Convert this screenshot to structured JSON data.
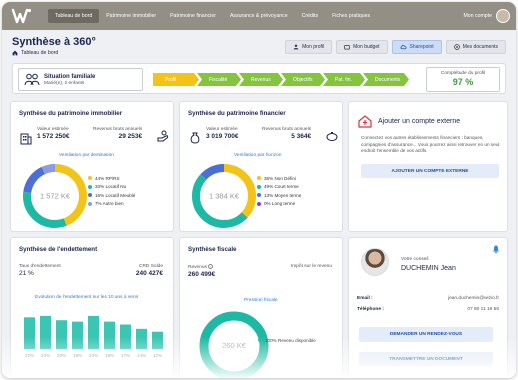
{
  "nav": {
    "items": [
      "Tableau de bord",
      "Patrimoine immobilier",
      "Patrimoine financier",
      "Assurance & prévoyance",
      "Crédits",
      "Fiches pratiques"
    ],
    "account_label": "Mon compte"
  },
  "header": {
    "title": "Synthèse à 360°",
    "breadcrumb": "Tableau de bord",
    "buttons": [
      "Mon profil",
      "Mon budget",
      "Sharepoint",
      "Mes documents"
    ]
  },
  "situation": {
    "title": "Situation familiale",
    "subtitle": "Marié(e), 2 enfants",
    "steps": [
      "Profil",
      "Fiscalité",
      "Revenus",
      "Objectifs",
      "Pat. fin.",
      "Documents"
    ],
    "completude_label": "Complétude du profil",
    "completude_value": "97 %"
  },
  "immobilier": {
    "title": "Synthèse du patrimoine immobilier",
    "value_label": "Valeur estimée",
    "value": "1 572 250€",
    "rent_label": "Revenus bruts annuels",
    "rent": "29 253€",
    "sub": "Ventilation par destination",
    "center": "1 572 K€",
    "legend": [
      {
        "label": "44% RP/RS",
        "color": "#f2c318"
      },
      {
        "label": "33% Locatif Nu",
        "color": "#1db9a5"
      },
      {
        "label": "16% Locatif Meublé",
        "color": "#4c6fd6"
      },
      {
        "label": "7% Autre bien",
        "color": "#8a9de0"
      }
    ]
  },
  "financier": {
    "title": "Synthèse du patrimoine financier",
    "value_label": "Valeur estimée",
    "value": "3 019 700€",
    "rent_label": "Revenus bruts annuels",
    "rent": "5 364€",
    "sub": "Ventilation par horizon",
    "center": "1 384 K€",
    "legend": [
      {
        "label": "36% Non Défini",
        "color": "#f2c318"
      },
      {
        "label": "49% Court terme",
        "color": "#1db9a5"
      },
      {
        "label": "13% Moyen terme",
        "color": "#4c6fd6"
      },
      {
        "label": "0% Long terme",
        "color": "#8a3fd0"
      }
    ]
  },
  "externe": {
    "title": "Ajouter un compte externe",
    "text": "Connectez vos autres établissements financiers : banques, compagnies d'assurance... Vous pourrez ainsi retrouver en un seul endroit l'ensemble de vos actifs.",
    "button": "AJOUTER UN COMPTE EXTERNE"
  },
  "endettement": {
    "title": "Synthèse de l'endettement",
    "rate_label": "Taux d'endettement",
    "rate": "21 %",
    "crd_label": "CRD Solde",
    "crd": "240 427€",
    "sub": "Evolution de l'endettement sur les 10 ans à venir",
    "bar_labels": [
      "22%",
      "23%",
      "20%",
      "19%",
      "23%",
      "19%",
      "17%",
      "14%",
      "12%"
    ]
  },
  "fiscale": {
    "title": "Synthèse fiscale",
    "rev_label": "Revenus",
    "rev": "260 499€",
    "impot_label": "Impôt sur le revenu",
    "impot": "",
    "sub": "Pression fiscale",
    "center": "260 K€",
    "legend": [
      {
        "label": "100% Revenu disponible",
        "color": "#1db9a5"
      }
    ]
  },
  "conseil": {
    "role": "Votre conseil",
    "name": "DUCHEMIN Jean",
    "email_label": "Email :",
    "email": "jean.duchemin@wizio.fr",
    "phone_label": "Téléphone :",
    "phone": "07 80 11 16 56",
    "rdv_button": "DEMANDER UN RENDEZ-VOUS",
    "doc_button": "TRANSMETTRE UN DOCUMENT"
  },
  "chart_data": [
    {
      "type": "pie",
      "title": "Ventilation par destination",
      "categories": [
        "RP/RS",
        "Locatif Nu",
        "Locatif Meublé",
        "Autre bien"
      ],
      "values": [
        44,
        33,
        16,
        7
      ]
    },
    {
      "type": "pie",
      "title": "Ventilation par horizon",
      "categories": [
        "Non Défini",
        "Court terme",
        "Moyen terme",
        "Long terme"
      ],
      "values": [
        36,
        49,
        13,
        0
      ]
    },
    {
      "type": "bar",
      "title": "Evolution de l'endettement sur les 10 ans à venir",
      "categories": [
        "",
        "",
        "",
        "",
        "",
        "",
        "",
        "",
        ""
      ],
      "values": [
        22,
        23,
        20,
        19,
        23,
        19,
        17,
        14,
        12
      ]
    },
    {
      "type": "pie",
      "title": "Pression fiscale",
      "categories": [
        "Revenu disponible"
      ],
      "values": [
        100
      ]
    }
  ]
}
